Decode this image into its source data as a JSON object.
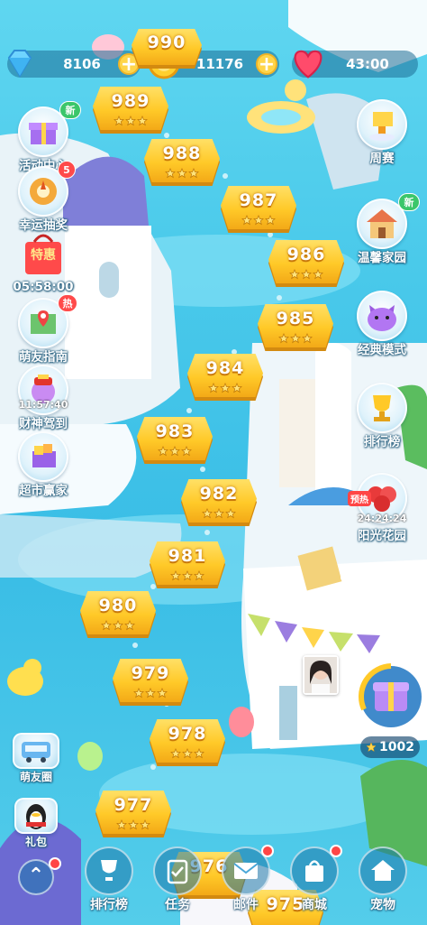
{
  "resources": {
    "diamonds": "8106",
    "coins": "11176",
    "lives_timer": "43:00"
  },
  "top_level": "990",
  "levels": [
    {
      "num": "989",
      "stars": 3
    },
    {
      "num": "988",
      "stars": 3
    },
    {
      "num": "987",
      "stars": 3
    },
    {
      "num": "986",
      "stars": 3
    },
    {
      "num": "985",
      "stars": 3
    },
    {
      "num": "984",
      "stars": 3
    },
    {
      "num": "983",
      "stars": 3
    },
    {
      "num": "982",
      "stars": 3
    },
    {
      "num": "981",
      "stars": 3
    },
    {
      "num": "980",
      "stars": 3
    },
    {
      "num": "979",
      "stars": 3
    },
    {
      "num": "978",
      "stars": 3
    },
    {
      "num": "977",
      "stars": 3
    },
    {
      "num": "976",
      "stars": 0
    },
    {
      "num": "975",
      "stars": 0
    }
  ],
  "left_menu": {
    "activity": {
      "label": "活动中心",
      "badge": "新"
    },
    "lottery": {
      "label": "幸运抽奖",
      "badge": "5"
    },
    "special": {
      "tag": "特惠",
      "timer": "05:58:00"
    },
    "guide": {
      "label": "萌友指南",
      "badge": "热"
    },
    "wealth": {
      "label": "财神驾到",
      "timer": "11:57:40"
    },
    "market": {
      "label": "超市赢家"
    },
    "friends_circle": {
      "label": "萌友圈"
    },
    "gift": {
      "label": "礼包"
    }
  },
  "right_menu": {
    "weekly": {
      "label": "周赛"
    },
    "home": {
      "label": "温馨家园",
      "badge": "新"
    },
    "classic": {
      "label": "经典模式"
    },
    "ranking": {
      "label": "排行榜"
    },
    "garden": {
      "label": "阳光花园",
      "tag": "预热",
      "timer": "24:24:24"
    }
  },
  "reward": {
    "count": "1002"
  },
  "bottom_nav": {
    "ranking": "排行榜",
    "tasks": "任务",
    "mail": "邮件",
    "shop": "商城",
    "pets": "宠物"
  },
  "colors": {
    "water": "#49c9ea",
    "tile": "#ffc928",
    "badge_red": "#ff4a4a",
    "badge_green": "#3bc66a"
  }
}
